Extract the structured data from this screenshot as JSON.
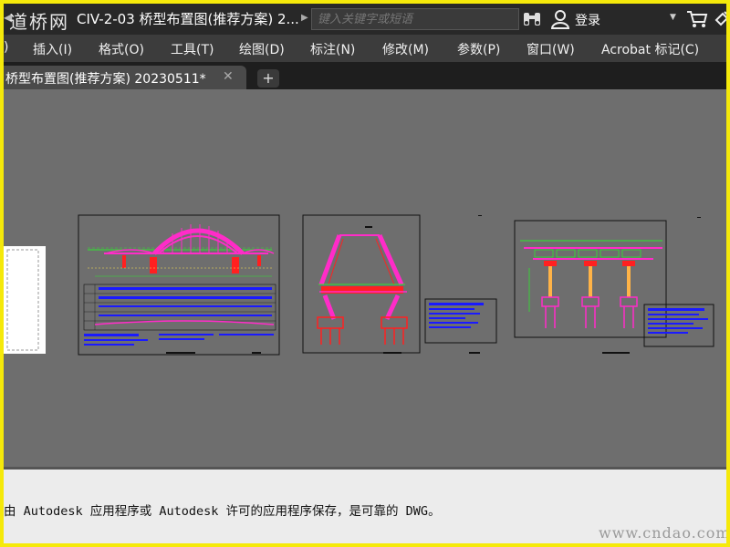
{
  "titlebar": {
    "logo": "道桥网",
    "document_title": "CIV-2-03 桥型布置图(推荐方案) 2...",
    "search_placeholder": "键入关键字或短语",
    "login_label": "登录"
  },
  "menu": {
    "items": [
      {
        "label": ")"
      },
      {
        "label": "插入(I)"
      },
      {
        "label": "格式(O)"
      },
      {
        "label": "工具(T)"
      },
      {
        "label": "绘图(D)"
      },
      {
        "label": "标注(N)"
      },
      {
        "label": "修改(M)"
      },
      {
        "label": "参数(P)"
      },
      {
        "label": "窗口(W)"
      },
      {
        "label": "Acrobat 标记(C)"
      }
    ]
  },
  "tabs": {
    "active_label": "桥型布置图(推荐方案) 20230511*",
    "close_glyph": "✕",
    "new_tab_glyph": "+"
  },
  "status": {
    "message": "由 Autodesk 应用程序或 Autodesk 许可的应用程序保存，是可靠的 DWG。",
    "watermark": "www.cndao.com"
  },
  "colors": {
    "frame_border": "#f5e90a",
    "titlebar_bg": "#282828",
    "menubar_bg": "#3c3c3c",
    "canvas_bg": "#6e6e6e",
    "cad_magenta": "#ff2cc8",
    "cad_red": "#ff2020",
    "cad_green": "#2ee82e",
    "cad_blue": "#1a1aff"
  },
  "icons": [
    "binoculars-icon",
    "user-icon",
    "cart-icon",
    "satellite-icon",
    "close-icon",
    "plus-icon"
  ]
}
